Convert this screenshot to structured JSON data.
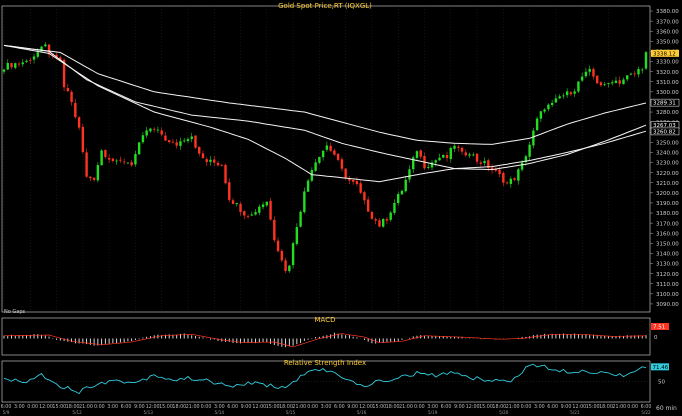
{
  "chart_data": [
    {
      "type": "candlestick",
      "title": "Gold Spot Price,RT (IQXGL)",
      "ylim": [
        3082,
        3385
      ],
      "y_ticks": [
        3090,
        3100,
        3110,
        3120,
        3130,
        3140,
        3150,
        3160,
        3170,
        3180,
        3190,
        3200,
        3210,
        3220,
        3230,
        3240,
        3250,
        3260,
        3270,
        3280,
        3290,
        3300,
        3310,
        3320,
        3330,
        3340,
        3350,
        3360,
        3370,
        3380
      ],
      "x_time_labels": [
        "6:00",
        "3:00",
        "0:00",
        "12:00",
        "15:00",
        "18:00",
        "21:00",
        "0:00",
        "3:00",
        "6:00",
        "9:00",
        "12:00",
        "15:00",
        "18:00",
        "21:00",
        "0:00",
        "3:00",
        "6:00",
        "9:00",
        "12:00",
        "15:00",
        "18:00",
        "21:00",
        "0:00",
        "3:00",
        "6:00",
        "9:00",
        "12:00",
        "15:00",
        "18:00",
        "21:00",
        "0:00",
        "3:00",
        "6:00",
        "9:00",
        "12:00",
        "15:00",
        "18:00",
        "21:00",
        "0:00",
        "3:00",
        "6:00",
        "9:00",
        "12:00",
        "15:00",
        "18:00",
        "21:00",
        "0:00",
        "6:00"
      ],
      "x_date_labels": [
        "5/9",
        "5/12",
        "5/13",
        "5/14",
        "5/15",
        "5/16",
        "5/19",
        "5/20",
        "5/21",
        "5/22"
      ],
      "anchor_closes": [
        [
          0,
          3325
        ],
        [
          3,
          3328
        ],
        [
          6,
          3330
        ],
        [
          9,
          3339
        ],
        [
          11,
          3345
        ],
        [
          13,
          3333
        ],
        [
          15,
          3332
        ],
        [
          16,
          3302
        ],
        [
          17,
          3301
        ],
        [
          18,
          3289
        ],
        [
          19,
          3276
        ],
        [
          20,
          3263
        ],
        [
          21,
          3240
        ],
        [
          22,
          3215
        ],
        [
          24,
          3215
        ],
        [
          26,
          3242
        ],
        [
          28,
          3235
        ],
        [
          30,
          3229
        ],
        [
          32,
          3232
        ],
        [
          34,
          3229
        ],
        [
          36,
          3247
        ],
        [
          38,
          3262
        ],
        [
          40,
          3262
        ],
        [
          42,
          3258
        ],
        [
          44,
          3249
        ],
        [
          46,
          3248
        ],
        [
          48,
          3254
        ],
        [
          50,
          3257
        ],
        [
          52,
          3237
        ],
        [
          54,
          3231
        ],
        [
          56,
          3230
        ],
        [
          58,
          3228
        ],
        [
          60,
          3195
        ],
        [
          62,
          3188
        ],
        [
          64,
          3180
        ],
        [
          66,
          3178
        ],
        [
          68,
          3187
        ],
        [
          70,
          3192
        ],
        [
          72,
          3155
        ],
        [
          74,
          3135
        ],
        [
          75,
          3122
        ],
        [
          76,
          3130
        ],
        [
          78,
          3168
        ],
        [
          80,
          3200
        ],
        [
          82,
          3225
        ],
        [
          84,
          3238
        ],
        [
          86,
          3247
        ],
        [
          88,
          3238
        ],
        [
          90,
          3222
        ],
        [
          92,
          3212
        ],
        [
          94,
          3207
        ],
        [
          96,
          3190
        ],
        [
          98,
          3177
        ],
        [
          100,
          3168
        ],
        [
          102,
          3175
        ],
        [
          104,
          3190
        ],
        [
          106,
          3203
        ],
        [
          108,
          3222
        ],
        [
          110,
          3243
        ],
        [
          112,
          3227
        ],
        [
          114,
          3230
        ],
        [
          116,
          3235
        ],
        [
          118,
          3235
        ],
        [
          120,
          3248
        ],
        [
          122,
          3238
        ],
        [
          124,
          3241
        ],
        [
          126,
          3232
        ],
        [
          128,
          3229
        ],
        [
          130,
          3223
        ],
        [
          132,
          3217
        ],
        [
          134,
          3209
        ],
        [
          136,
          3215
        ],
        [
          138,
          3228
        ],
        [
          140,
          3248
        ],
        [
          142,
          3272
        ],
        [
          144,
          3285
        ],
        [
          146,
          3287
        ],
        [
          148,
          3295
        ],
        [
          150,
          3298
        ],
        [
          152,
          3303
        ],
        [
          154,
          3315
        ],
        [
          156,
          3320
        ],
        [
          158,
          3310
        ],
        [
          160,
          3305
        ],
        [
          162,
          3312
        ],
        [
          164,
          3310
        ],
        [
          166,
          3315
        ],
        [
          168,
          3318
        ],
        [
          170,
          3325
        ],
        [
          171,
          3338
        ]
      ],
      "series": [
        {
          "name": "",
          "values_at": [
            [
              0,
              3346
            ],
            [
              15,
              3339
            ],
            [
              25,
              3318
            ],
            [
              40,
              3300
            ],
            [
              60,
              3289
            ],
            [
              80,
              3280
            ],
            [
              90,
              3270
            ],
            [
              100,
              3260
            ],
            [
              110,
              3252
            ],
            [
              120,
              3249
            ],
            [
              130,
              3248
            ],
            [
              140,
              3254
            ],
            [
              150,
              3268
            ],
            [
              160,
              3279
            ],
            [
              171,
              3289
            ]
          ]
        },
        {
          "name": "",
          "values_at": [
            [
              0,
              3346
            ],
            [
              12,
              3340
            ],
            [
              22,
              3312
            ],
            [
              35,
              3290
            ],
            [
              50,
              3277
            ],
            [
              65,
              3271
            ],
            [
              80,
              3262
            ],
            [
              90,
              3249
            ],
            [
              100,
              3240
            ],
            [
              110,
              3232
            ],
            [
              120,
              3224
            ],
            [
              130,
              3223
            ],
            [
              140,
              3229
            ],
            [
              150,
              3238
            ],
            [
              160,
              3251
            ],
            [
              171,
              3267
            ]
          ]
        },
        {
          "name": "",
          "values_at": [
            [
              0,
              3346
            ],
            [
              12,
              3338
            ],
            [
              25,
              3306
            ],
            [
              40,
              3280
            ],
            [
              55,
              3265
            ],
            [
              65,
              3253
            ],
            [
              75,
              3234
            ],
            [
              82,
              3218
            ],
            [
              90,
              3215
            ],
            [
              100,
              3211
            ],
            [
              110,
              3218
            ],
            [
              120,
              3224
            ],
            [
              130,
              3226
            ],
            [
              140,
              3232
            ],
            [
              150,
              3240
            ],
            [
              160,
              3249
            ],
            [
              171,
              3261
            ]
          ]
        }
      ],
      "value_labels": [
        {
          "value": 3338.12,
          "color": "#ffcc33"
        },
        {
          "value": 3289.31,
          "color": "#ffffff"
        },
        {
          "value": 3267.03,
          "color": "#ffffff"
        },
        {
          "value": 3260.82,
          "color": "#ffffff"
        }
      ]
    },
    {
      "type": "bar",
      "title": "MACD",
      "ylim": [
        -1,
        1
      ],
      "value_label": "7.51",
      "value_label2": "0",
      "anchors": [
        [
          0,
          0.2
        ],
        [
          10,
          0.25
        ],
        [
          16,
          -0.2
        ],
        [
          24,
          -0.45
        ],
        [
          32,
          -0.25
        ],
        [
          40,
          0.2
        ],
        [
          48,
          0.3
        ],
        [
          56,
          -0.1
        ],
        [
          62,
          -0.3
        ],
        [
          70,
          -0.25
        ],
        [
          75,
          -0.6
        ],
        [
          82,
          0.0
        ],
        [
          88,
          0.35
        ],
        [
          94,
          0.1
        ],
        [
          98,
          -0.3
        ],
        [
          104,
          -0.2
        ],
        [
          110,
          0.2
        ],
        [
          120,
          0.1
        ],
        [
          130,
          -0.05
        ],
        [
          136,
          0.0
        ],
        [
          144,
          0.3
        ],
        [
          152,
          0.3
        ],
        [
          160,
          0.15
        ],
        [
          171,
          0.2
        ]
      ]
    },
    {
      "type": "line",
      "title": "Relative Strength Index",
      "ylim": [
        20,
        80
      ],
      "y_ticks": [
        50
      ],
      "value_label": "71.46",
      "anchors": [
        [
          0,
          55
        ],
        [
          5,
          48
        ],
        [
          10,
          60
        ],
        [
          15,
          44
        ],
        [
          20,
          35
        ],
        [
          25,
          48
        ],
        [
          30,
          51
        ],
        [
          35,
          48
        ],
        [
          40,
          60
        ],
        [
          45,
          52
        ],
        [
          50,
          55
        ],
        [
          55,
          50
        ],
        [
          60,
          42
        ],
        [
          65,
          48
        ],
        [
          70,
          45
        ],
        [
          75,
          40
        ],
        [
          80,
          62
        ],
        [
          85,
          67
        ],
        [
          90,
          58
        ],
        [
          95,
          43
        ],
        [
          100,
          50
        ],
        [
          105,
          55
        ],
        [
          110,
          62
        ],
        [
          115,
          58
        ],
        [
          120,
          64
        ],
        [
          125,
          55
        ],
        [
          130,
          52
        ],
        [
          135,
          50
        ],
        [
          140,
          75
        ],
        [
          145,
          70
        ],
        [
          150,
          65
        ],
        [
          155,
          66
        ],
        [
          160,
          62
        ],
        [
          165,
          60
        ],
        [
          171,
          71
        ]
      ]
    }
  ],
  "footer": {
    "interval": "60 min"
  },
  "no_gaps": "No Gaps"
}
